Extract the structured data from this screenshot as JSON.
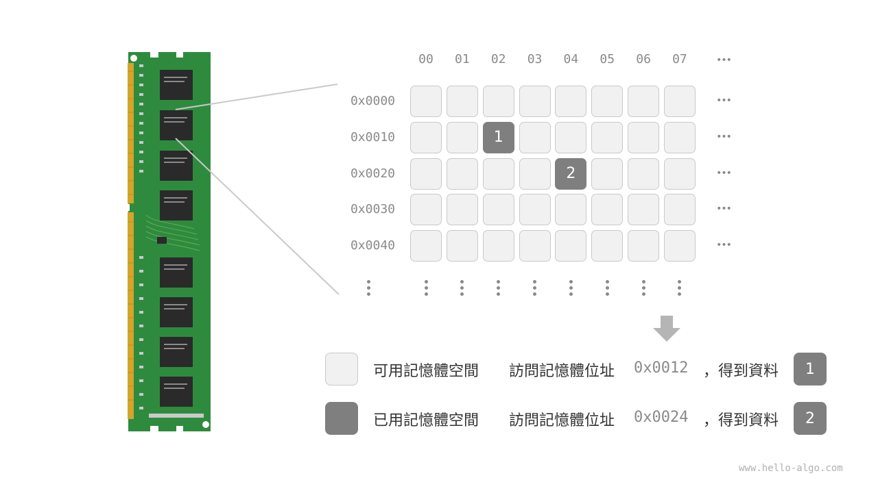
{
  "columns": [
    "00",
    "01",
    "02",
    "03",
    "04",
    "05",
    "06",
    "07"
  ],
  "rows": [
    "0x0000",
    "0x0010",
    "0x0020",
    "0x0030",
    "0x0040"
  ],
  "used_cells": [
    {
      "row": 1,
      "col": 2,
      "value": "1"
    },
    {
      "row": 2,
      "col": 4,
      "value": "2"
    }
  ],
  "ellipsis": "•••",
  "legend": {
    "free_label": "可用記憶體空間",
    "used_label": "已用記憶體空間"
  },
  "accesses": [
    {
      "prefix": "訪問記憶體位址",
      "address": "0x0012",
      "suffix": "，得到資料",
      "value": "1"
    },
    {
      "prefix": "訪問記憶體位址",
      "address": "0x0024",
      "suffix": "，得到資料",
      "value": "2"
    }
  ],
  "colors": {
    "used": "#7f7f7f",
    "free": "#f1f1f1",
    "pcb": "#2e8b3e",
    "chip": "#2a2a2a",
    "gold": "#d4a52a"
  },
  "watermark": "www.hello-algo.com"
}
